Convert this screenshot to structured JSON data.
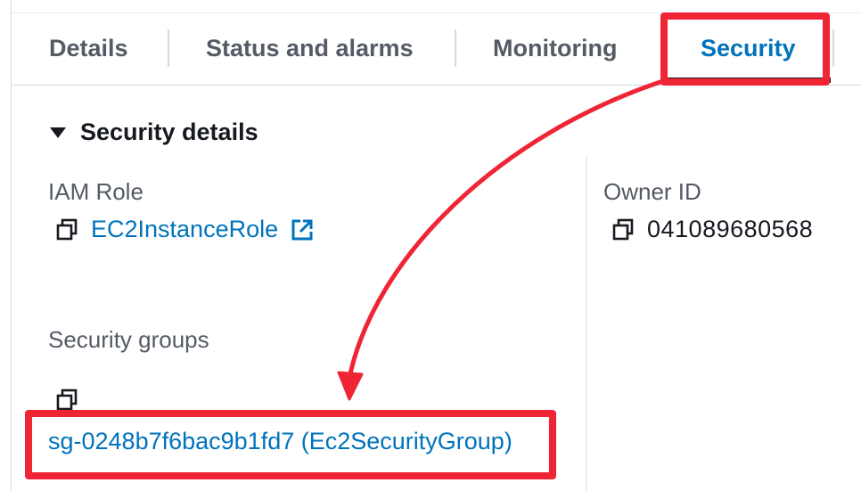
{
  "tabs": [
    {
      "label": "Details",
      "active": false
    },
    {
      "label": "Status and alarms",
      "active": false
    },
    {
      "label": "Monitoring",
      "active": false
    },
    {
      "label": "Security",
      "active": true
    }
  ],
  "section": {
    "title": "Security details",
    "expanded": true
  },
  "fields": {
    "iam_role": {
      "label": "IAM Role",
      "value": "EC2InstanceRole"
    },
    "owner_id": {
      "label": "Owner ID",
      "value": "041089680568"
    },
    "security_groups": {
      "label": "Security groups",
      "value": "sg-0248b7f6bac9b1fd7 (Ec2SecurityGroup)"
    }
  },
  "colors": {
    "link": "#0073bb",
    "annotation": "#ef2536",
    "text": "#16191f",
    "muted": "#545b64"
  },
  "icons": [
    "copy-icon",
    "external-link-icon",
    "caret-down-icon"
  ]
}
